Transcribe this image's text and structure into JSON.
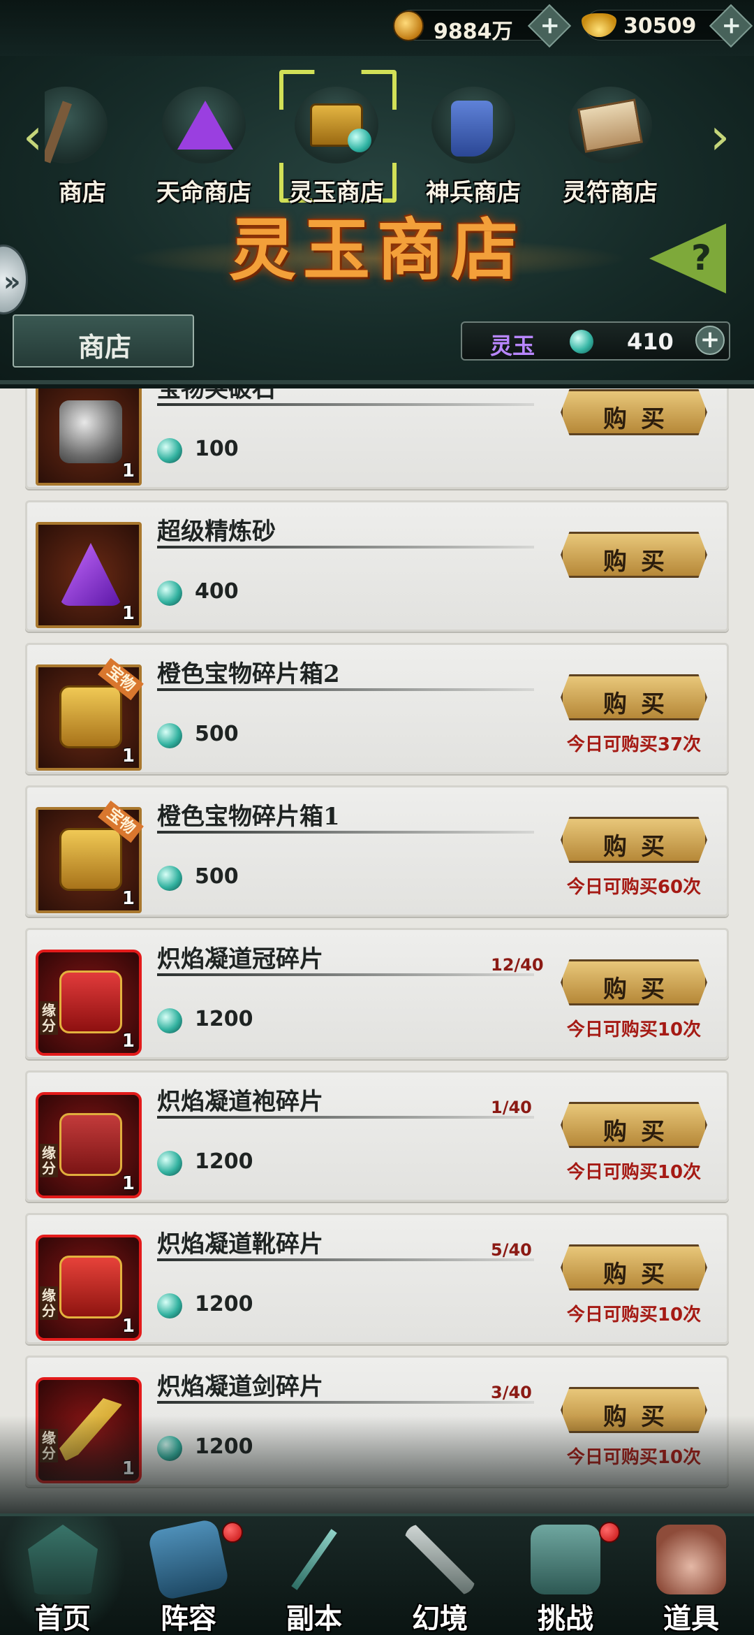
{
  "currencies": {
    "coins": "9884万",
    "gold": "30509",
    "plus_label": "+"
  },
  "shop_tabs": [
    {
      "label": "商店"
    },
    {
      "label": "天命商店"
    },
    {
      "label": "灵玉商店",
      "selected": true
    },
    {
      "label": "神兵商店"
    },
    {
      "label": "灵符商店"
    }
  ],
  "nav_arrows": {
    "left": "‹",
    "right": "›"
  },
  "header": {
    "title": "灵玉商店",
    "shop_button": "商店",
    "side_button": "»",
    "help_icon": "?",
    "balance": {
      "label": "灵玉",
      "value": "410",
      "plus": "+"
    }
  },
  "buy_label": "购买",
  "items": [
    {
      "name": "宝物突破石",
      "price": "100",
      "qty": "1",
      "icon": "stone-icon",
      "limit": "",
      "progress": "",
      "tag": "",
      "bond": ""
    },
    {
      "name": "超级精炼砂",
      "price": "400",
      "qty": "1",
      "icon": "refine-sand-icon",
      "limit": "",
      "progress": "",
      "tag": "",
      "bond": ""
    },
    {
      "name": "橙色宝物碎片箱2",
      "price": "500",
      "qty": "1",
      "icon": "treasure-chest-icon",
      "limit": "今日可购买37次",
      "progress": "",
      "tag": "宝物",
      "bond": ""
    },
    {
      "name": "橙色宝物碎片箱1",
      "price": "500",
      "qty": "1",
      "icon": "treasure-chest-icon",
      "limit": "今日可购买60次",
      "progress": "",
      "tag": "宝物",
      "bond": ""
    },
    {
      "name": "炽焰凝道冠碎片",
      "price": "1200",
      "qty": "1",
      "icon": "crown-icon",
      "limit": "今日可购买10次",
      "progress": "12/40",
      "tag": "",
      "bond": "缘分"
    },
    {
      "name": "炽焰凝道袍碎片",
      "price": "1200",
      "qty": "1",
      "icon": "robe-icon",
      "limit": "今日可购买10次",
      "progress": "1/40",
      "tag": "",
      "bond": "缘分"
    },
    {
      "name": "炽焰凝道靴碎片",
      "price": "1200",
      "qty": "1",
      "icon": "boots-icon",
      "limit": "今日可购买10次",
      "progress": "5/40",
      "tag": "",
      "bond": "缘分"
    },
    {
      "name": "炽焰凝道剑碎片",
      "price": "1200",
      "qty": "1",
      "icon": "sword-icon",
      "limit": "今日可购买10次",
      "progress": "3/40",
      "tag": "",
      "bond": "缘分"
    }
  ],
  "bottom_nav": [
    {
      "label": "首页",
      "badge": false
    },
    {
      "label": "阵容",
      "badge": true
    },
    {
      "label": "副本",
      "badge": false
    },
    {
      "label": "幻境",
      "badge": false
    },
    {
      "label": "挑战",
      "badge": true
    },
    {
      "label": "道具",
      "badge": false
    }
  ]
}
